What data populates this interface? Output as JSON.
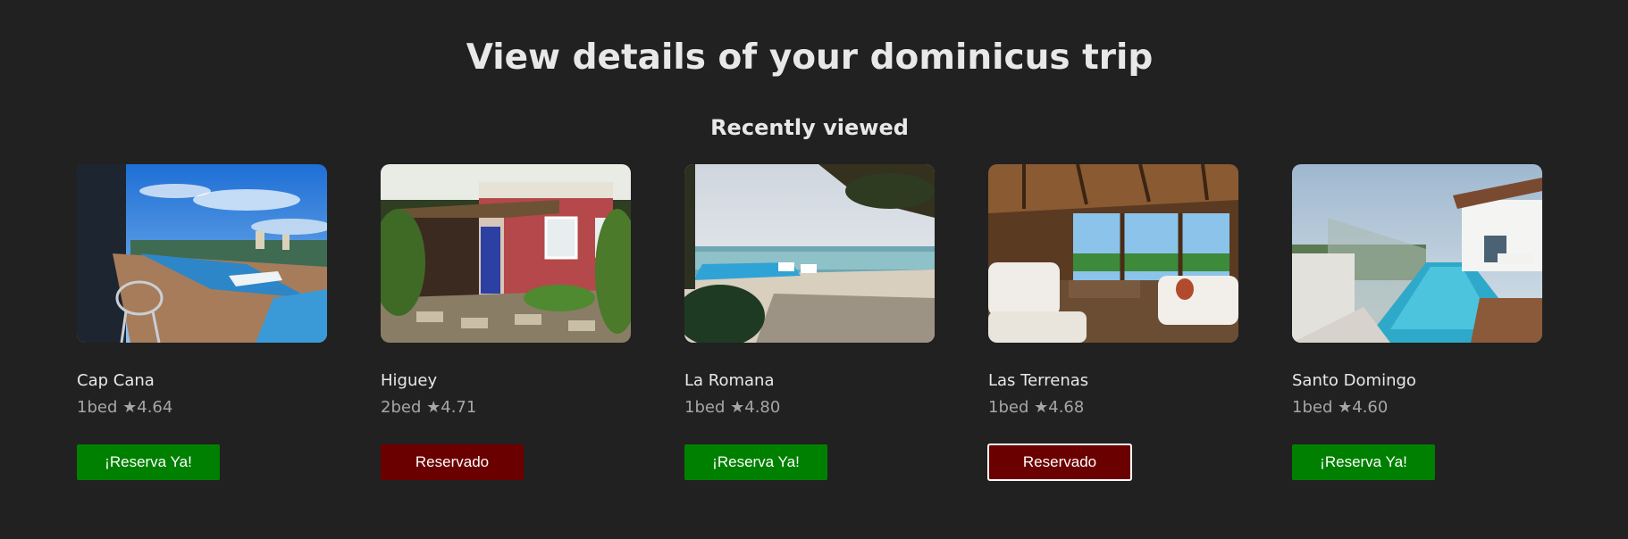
{
  "header": {
    "title": "View details of your dominicus trip",
    "section_title": "Recently viewed"
  },
  "colors": {
    "background": "#212121",
    "available_button": "#008000",
    "reserved_button": "#6b0000"
  },
  "cards": [
    {
      "location": "Cap Cana",
      "details": "1bed ★4.64",
      "button_label": "¡Reserva Ya!",
      "status": "available",
      "image_icon": "rooftop-pool-photo"
    },
    {
      "location": "Higuey",
      "details": "2bed ★4.71",
      "button_label": "Reservado",
      "status": "reserved",
      "image_icon": "red-house-photo"
    },
    {
      "location": "La Romana",
      "details": "1bed ★4.80",
      "button_label": "¡Reserva Ya!",
      "status": "available",
      "image_icon": "beach-pool-photo"
    },
    {
      "location": "Las Terrenas",
      "details": "1bed ★4.68",
      "button_label": "Reservado",
      "status": "reserved",
      "image_icon": "terrace-lounge-photo"
    },
    {
      "location": "Santo Domingo",
      "details": "1bed ★4.60",
      "button_label": "¡Reserva Ya!",
      "status": "available",
      "image_icon": "balcony-pool-photo"
    }
  ]
}
